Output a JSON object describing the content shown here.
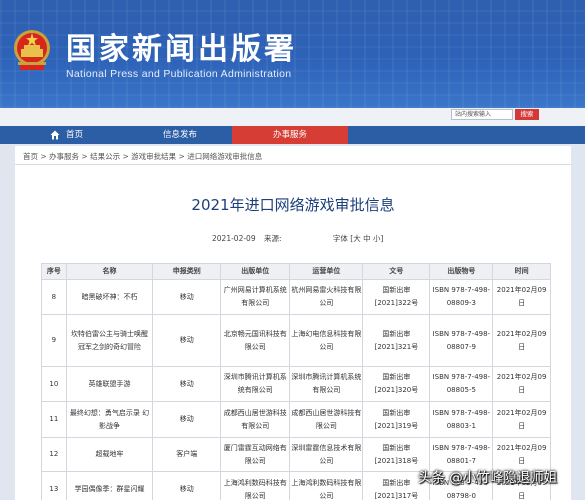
{
  "header": {
    "site_title": "国家新闻出版署",
    "site_subtitle": "National Press and Publication Administration",
    "search_placeholder": "站内搜索输入",
    "search_button": "搜索"
  },
  "nav": {
    "items": [
      {
        "label": "首页",
        "icon": "home-icon"
      },
      {
        "label": "信息发布"
      },
      {
        "label": "办事服务",
        "active": true
      }
    ]
  },
  "breadcrumb": [
    "首页",
    "办事服务",
    "结果公示",
    "游戏审批结果",
    "进口网络游戏审批信息"
  ],
  "breadcrumb_text": "首页 > 办事服务 > 结果公示 > 游戏审批结果 > 进口网络游戏审批信息",
  "article": {
    "title": "2021年进口网络游戏审批信息",
    "date": "2021-02-09",
    "source_label": "来源:",
    "font_size_label": "字体 [大 中 小]"
  },
  "table": {
    "headers": [
      "序号",
      "名称",
      "申报类别",
      "出版单位",
      "运营单位",
      "文号",
      "出版物号",
      "时间"
    ],
    "rows": [
      {
        "no": "8",
        "name": "暗黑破坏神：不朽",
        "type": "移动",
        "publisher": "广州网易计算机系统有限公司",
        "operator": "杭州网易雷火科技有限公司",
        "docno": "国新出审[2021]322号",
        "isbn": "ISBN 978-7-498-08809-3",
        "time": "2021年02月09日"
      },
      {
        "no": "9",
        "name": "坎特伯雷公主与骑士唤醒冠军之剑的奇幻冒险",
        "type": "移动",
        "publisher": "北京畅元国讯科技有限公司",
        "operator": "上海幻电信息科技有限公司",
        "docno": "国新出审[2021]321号",
        "isbn": "ISBN 978-7-498-08807-9",
        "time": "2021年02月09日"
      },
      {
        "no": "10",
        "name": "英雄联盟手游",
        "type": "移动",
        "publisher": "深圳市腾讯计算机系统有限公司",
        "operator": "深圳市腾讯计算机系统有限公司",
        "docno": "国新出审[2021]320号",
        "isbn": "ISBN 978-7-498-08805-5",
        "time": "2021年02月09日"
      },
      {
        "no": "11",
        "name": "最终幻想：勇气启示录 幻影战争",
        "type": "移动",
        "publisher": "成都西山居世游科技有限公司",
        "operator": "成都西山居世游科技有限公司",
        "docno": "国新出审[2021]319号",
        "isbn": "ISBN 978-7-498-08803-1",
        "time": "2021年02月09日"
      },
      {
        "no": "12",
        "name": "超载地牢",
        "type": "客户端",
        "publisher": "厦门雷霆互动网络有限公司",
        "operator": "深圳雷霆信息技术有限公司",
        "docno": "国新出审[2021]318号",
        "isbn": "ISBN 978-7-498-08801-7",
        "time": "2021年02月09日"
      },
      {
        "no": "13",
        "name": "学园偶像季：群星闪耀",
        "type": "移动",
        "publisher": "上海鸿利数码科技有限公司",
        "operator": "上海鸿利数码科技有限公司",
        "docno": "国新出审[2021]317号",
        "isbn": "ISBN 978-7-498-08798-0",
        "time": "2021年02月09日"
      }
    ]
  },
  "watermark": "头条 @小竹峰隐退师姐"
}
